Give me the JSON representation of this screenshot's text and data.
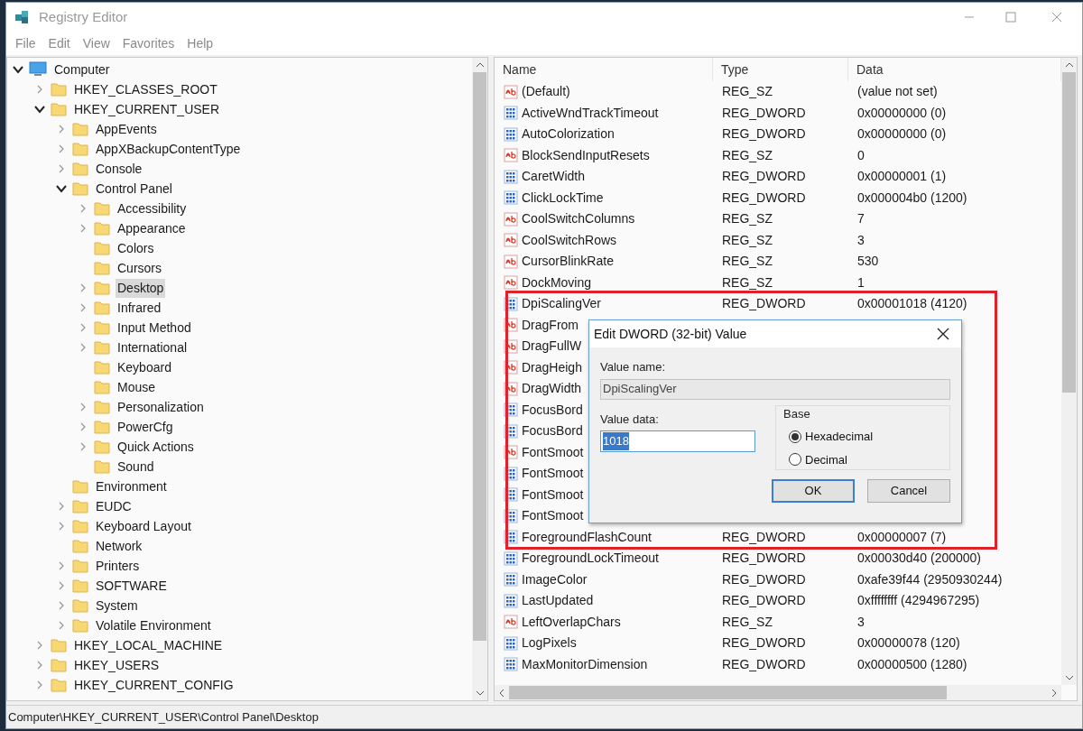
{
  "window": {
    "title": "Registry Editor"
  },
  "menu": [
    "File",
    "Edit",
    "View",
    "Favorites",
    "Help"
  ],
  "tree": {
    "items": [
      {
        "label": "Computer",
        "kind": "computer",
        "expandable": true,
        "expanded": true,
        "selected": false,
        "children": [
          {
            "label": "HKEY_CLASSES_ROOT",
            "expandable": true,
            "expanded": false,
            "selected": false
          },
          {
            "label": "HKEY_CURRENT_USER",
            "expandable": true,
            "expanded": true,
            "selected": false,
            "children": [
              {
                "label": "AppEvents",
                "expandable": true,
                "expanded": false,
                "selected": false
              },
              {
                "label": "AppXBackupContentType",
                "expandable": true,
                "expanded": false,
                "selected": false
              },
              {
                "label": "Console",
                "expandable": true,
                "expanded": false,
                "selected": false
              },
              {
                "label": "Control Panel",
                "expandable": true,
                "expanded": true,
                "selected": false,
                "children": [
                  {
                    "label": "Accessibility",
                    "expandable": true,
                    "expanded": false,
                    "selected": false
                  },
                  {
                    "label": "Appearance",
                    "expandable": true,
                    "expanded": false,
                    "selected": false
                  },
                  {
                    "label": "Colors",
                    "expandable": false,
                    "selected": false
                  },
                  {
                    "label": "Cursors",
                    "expandable": false,
                    "selected": false
                  },
                  {
                    "label": "Desktop",
                    "expandable": true,
                    "expanded": false,
                    "selected": true
                  },
                  {
                    "label": "Infrared",
                    "expandable": true,
                    "expanded": false,
                    "selected": false
                  },
                  {
                    "label": "Input Method",
                    "expandable": true,
                    "expanded": false,
                    "selected": false
                  },
                  {
                    "label": "International",
                    "expandable": true,
                    "expanded": false,
                    "selected": false
                  },
                  {
                    "label": "Keyboard",
                    "expandable": false,
                    "selected": false
                  },
                  {
                    "label": "Mouse",
                    "expandable": false,
                    "selected": false
                  },
                  {
                    "label": "Personalization",
                    "expandable": true,
                    "expanded": false,
                    "selected": false
                  },
                  {
                    "label": "PowerCfg",
                    "expandable": true,
                    "expanded": false,
                    "selected": false
                  },
                  {
                    "label": "Quick Actions",
                    "expandable": true,
                    "expanded": false,
                    "selected": false
                  },
                  {
                    "label": "Sound",
                    "expandable": false,
                    "selected": false
                  }
                ]
              },
              {
                "label": "Environment",
                "expandable": false,
                "selected": false
              },
              {
                "label": "EUDC",
                "expandable": true,
                "expanded": false,
                "selected": false
              },
              {
                "label": "Keyboard Layout",
                "expandable": true,
                "expanded": false,
                "selected": false
              },
              {
                "label": "Network",
                "expandable": false,
                "selected": false
              },
              {
                "label": "Printers",
                "expandable": true,
                "expanded": false,
                "selected": false
              },
              {
                "label": "SOFTWARE",
                "expandable": true,
                "expanded": false,
                "selected": false
              },
              {
                "label": "System",
                "expandable": true,
                "expanded": false,
                "selected": false
              },
              {
                "label": "Volatile Environment",
                "expandable": true,
                "expanded": false,
                "selected": false
              }
            ]
          },
          {
            "label": "HKEY_LOCAL_MACHINE",
            "expandable": true,
            "expanded": false,
            "selected": false
          },
          {
            "label": "HKEY_USERS",
            "expandable": true,
            "expanded": false,
            "selected": false
          },
          {
            "label": "HKEY_CURRENT_CONFIG",
            "expandable": true,
            "expanded": false,
            "selected": false
          }
        ]
      }
    ]
  },
  "values": {
    "columns": [
      "Name",
      "Type",
      "Data"
    ],
    "rows": [
      {
        "kind": "sz",
        "name": "(Default)",
        "type": "REG_SZ",
        "data": "(value not set)"
      },
      {
        "kind": "dword",
        "name": "ActiveWndTrackTimeout",
        "type": "REG_DWORD",
        "data": "0x00000000 (0)"
      },
      {
        "kind": "dword",
        "name": "AutoColorization",
        "type": "REG_DWORD",
        "data": "0x00000000 (0)"
      },
      {
        "kind": "sz",
        "name": "BlockSendInputResets",
        "type": "REG_SZ",
        "data": "0"
      },
      {
        "kind": "dword",
        "name": "CaretWidth",
        "type": "REG_DWORD",
        "data": "0x00000001 (1)"
      },
      {
        "kind": "dword",
        "name": "ClickLockTime",
        "type": "REG_DWORD",
        "data": "0x000004b0 (1200)"
      },
      {
        "kind": "sz",
        "name": "CoolSwitchColumns",
        "type": "REG_SZ",
        "data": "7"
      },
      {
        "kind": "sz",
        "name": "CoolSwitchRows",
        "type": "REG_SZ",
        "data": "3"
      },
      {
        "kind": "sz",
        "name": "CursorBlinkRate",
        "type": "REG_SZ",
        "data": "530"
      },
      {
        "kind": "sz",
        "name": "DockMoving",
        "type": "REG_SZ",
        "data": "1"
      },
      {
        "kind": "dword",
        "name": "DpiScalingVer",
        "type": "REG_DWORD",
        "data": "0x00001018 (4120)"
      },
      {
        "kind": "sz",
        "name": "DragFrom"
      },
      {
        "kind": "sz",
        "name": "DragFullW"
      },
      {
        "kind": "sz",
        "name": "DragHeigh"
      },
      {
        "kind": "sz",
        "name": "DragWidth"
      },
      {
        "kind": "dword",
        "name": "FocusBord"
      },
      {
        "kind": "dword",
        "name": "FocusBord"
      },
      {
        "kind": "sz",
        "name": "FontSmoot"
      },
      {
        "kind": "dword",
        "name": "FontSmoot"
      },
      {
        "kind": "dword",
        "name": "FontSmoot"
      },
      {
        "kind": "dword",
        "name": "FontSmoot"
      },
      {
        "kind": "dword",
        "name": "ForegroundFlashCount",
        "type": "REG_DWORD",
        "data": "0x00000007 (7)"
      },
      {
        "kind": "dword",
        "name": "ForegroundLockTimeout",
        "type": "REG_DWORD",
        "data": "0x00030d40 (200000)"
      },
      {
        "kind": "dword",
        "name": "ImageColor",
        "type": "REG_DWORD",
        "data": "0xafe39f44 (2950930244)"
      },
      {
        "kind": "dword",
        "name": "LastUpdated",
        "type": "REG_DWORD",
        "data": "0xffffffff (4294967295)"
      },
      {
        "kind": "sz",
        "name": "LeftOverlapChars",
        "type": "REG_SZ",
        "data": "3"
      },
      {
        "kind": "dword",
        "name": "LogPixels",
        "type": "REG_DWORD",
        "data": "0x00000078 (120)"
      },
      {
        "kind": "dword",
        "name": "MaxMonitorDimension",
        "type": "REG_DWORD",
        "data": "0x00000500 (1280)"
      }
    ]
  },
  "dialog": {
    "title": "Edit DWORD (32-bit) Value",
    "value_name_label": "Value name:",
    "value_name": "DpiScalingVer",
    "value_data_label": "Value data:",
    "value_data": "1018",
    "base_label": "Base",
    "base_options": [
      {
        "label": "Hexadecimal",
        "selected": true
      },
      {
        "label": "Decimal",
        "selected": false
      }
    ],
    "buttons": [
      {
        "label": "OK",
        "default": true
      },
      {
        "label": "Cancel",
        "default": false
      }
    ]
  },
  "status_bar": "Computer\\HKEY_CURRENT_USER\\Control Panel\\Desktop"
}
